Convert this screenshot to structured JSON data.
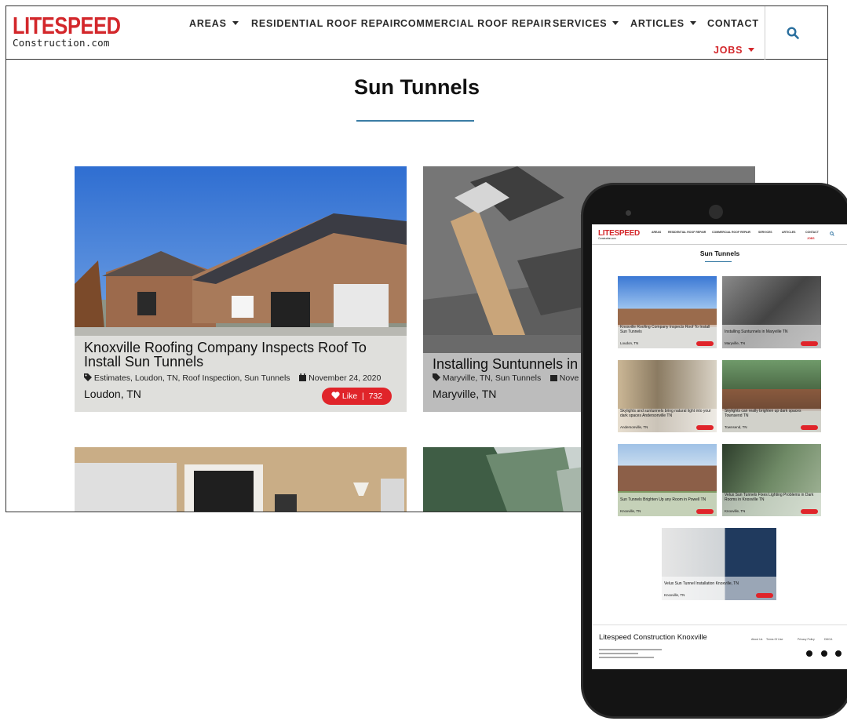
{
  "logo": {
    "word": "LITESPEED",
    "sub": "Construction.com"
  },
  "nav": {
    "areas": "AREAS",
    "residential": "RESIDENTIAL ROOF REPAIR",
    "commercial": "COMMERCIAL ROOF REPAIR",
    "services": "SERVICES",
    "articles": "ARTICLES",
    "contact": "CONTACT",
    "jobs": "JOBS"
  },
  "page": {
    "title": "Sun Tunnels"
  },
  "cards": [
    {
      "title": "Knoxville Roofing Company Inspects Roof To Install Sun Tunnels",
      "tags": "Estimates, Loudon, TN, Roof Inspection, Sun Tunnels",
      "date": "November 24, 2020",
      "location": "Loudon, TN",
      "like_label": "Like",
      "like_count": "732"
    },
    {
      "title": "Installing Suntunnels in Maryville TN",
      "tags": "Maryville, TN, Sun Tunnels",
      "date": "Nove",
      "location": "Maryville, TN"
    }
  ],
  "mobile": {
    "cards": [
      {
        "title": "Knoxville Roofing Company Inspects Roof To Install Sun Tunnels",
        "location": "Loudon, TN"
      },
      {
        "title": "Installing Suntunnels in Maryville TN",
        "location": "Maryville, TN"
      },
      {
        "title": "Skylights and suntunnels bring natural light into your dark spaces Andersonville TN",
        "location": "Andersonville, TN"
      },
      {
        "title": "Skylights can really brighten up dark spaces Townsend TN",
        "location": "Townsend, TN"
      },
      {
        "title": "Sun Tunnels Brighten Up any Room in Powell TN",
        "location": "Knoxville, TN"
      },
      {
        "title": "Velux Sun Tunnels Fixes Lighting Problems in Dark Rooms in Knoxville TN",
        "location": "Knoxville, TN"
      },
      {
        "title": "Velux Sun Tunnel Installation Knoxville, TN",
        "location": "Knoxville, TN"
      }
    ],
    "footer": {
      "title": "Litespeed Construction Knoxville",
      "links": [
        "About Us",
        "Terms Of Use",
        "Privacy Policy",
        "DMCA"
      ]
    }
  },
  "colors": {
    "brand_red": "#d3272b",
    "rule_blue": "#3a7ca5",
    "like_red": "#e0242a"
  },
  "icons": [
    "search-icon",
    "tag-icon",
    "calendar-icon",
    "heart-icon",
    "caret-down-icon"
  ]
}
